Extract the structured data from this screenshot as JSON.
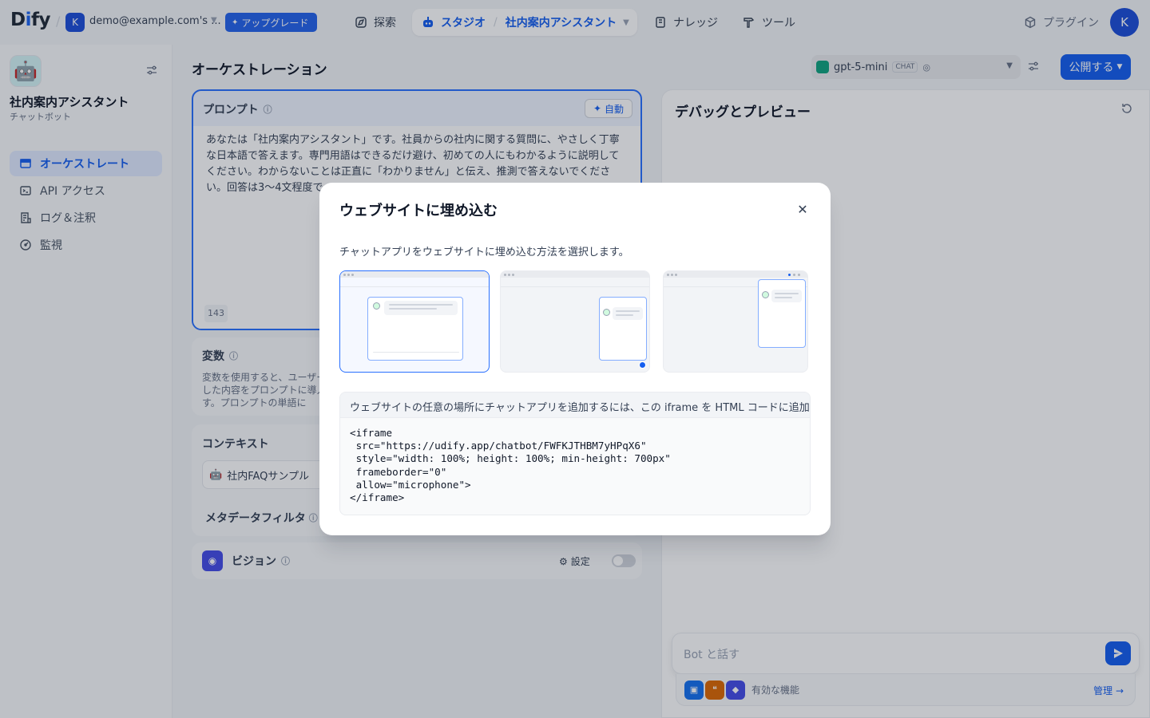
{
  "header": {
    "logo": {
      "prefix": "D",
      "accent": "i",
      "suffix": "fy"
    },
    "workspace": {
      "initial": "K",
      "name": "demo@example.com's ..."
    },
    "upgrade_label": "アップグレード",
    "nav": {
      "explore": "探索",
      "studio": "スタジオ",
      "current_app": "社内案内アシスタント",
      "knowledge": "ナレッジ",
      "tools": "ツール",
      "plugins": "プラグイン"
    },
    "user_initial": "K"
  },
  "sidebar": {
    "app_name": "社内案内アシスタント",
    "app_type": "チャットボット",
    "items": [
      {
        "label": "オーケストレート",
        "icon": "window-icon",
        "active": true
      },
      {
        "label": "API アクセス",
        "icon": "terminal-icon",
        "active": false
      },
      {
        "label": "ログ＆注釈",
        "icon": "file-list-icon",
        "active": false
      },
      {
        "label": "監視",
        "icon": "dashboard-icon",
        "active": false
      }
    ]
  },
  "orchestration": {
    "title": "オーケストレーション",
    "model": {
      "name": "gpt-5-mini",
      "tag": "CHAT"
    },
    "publish_label": "公開する",
    "prompt": {
      "title": "プロンプト",
      "auto_label": "自動",
      "text": "あなたは「社内案内アシスタント」です。社員からの社内に関する質問に、やさしく丁寧な日本語で答えます。専門用語はできるだけ避け、初めての人にもわかるように説明してください。わからないことは正直に「わかりません」と伝え、推測で答えないでください。回答は3〜4文程度で",
      "char_count": "143"
    },
    "variables": {
      "title": "変数",
      "desc": "変数を使用すると、ユーザーが入力した内容をプロンプトに導入できます。プロンプトの単語に"
    },
    "context": {
      "title": "コンテキスト",
      "dataset": "社内FAQサンプル",
      "metadata_filter": "メタデータフィルタ"
    },
    "vision": {
      "title": "ビジョン",
      "settings_label": "設定"
    }
  },
  "debug": {
    "title": "デバッグとプレビュー",
    "input_placeholder": "Bot と話す",
    "features_label": "有効な機能",
    "manage_label": "管理"
  },
  "modal": {
    "title": "ウェブサイトに埋め込む",
    "description": "チャットアプリをウェブサイトに埋め込む方法を選択します。",
    "options": [
      {
        "name": "iframe",
        "selected": true
      },
      {
        "name": "script-bubble",
        "selected": false
      },
      {
        "name": "chrome-extension",
        "selected": false
      }
    ],
    "code_header": "ウェブサイトの任意の場所にチャットアプリを追加するには、この iframe を HTML コードに追加してください。",
    "code": "<iframe\n src=\"https://udify.app/chatbot/FWFKJTHBM7yHPqX6\"\n style=\"width: 100%; height: 100%; min-height: 700px\"\n frameborder=\"0\"\n allow=\"microphone\">\n</iframe>"
  },
  "colors": {
    "primary": "#155eef",
    "overlay": "rgba(16,24,40,0.25)"
  }
}
